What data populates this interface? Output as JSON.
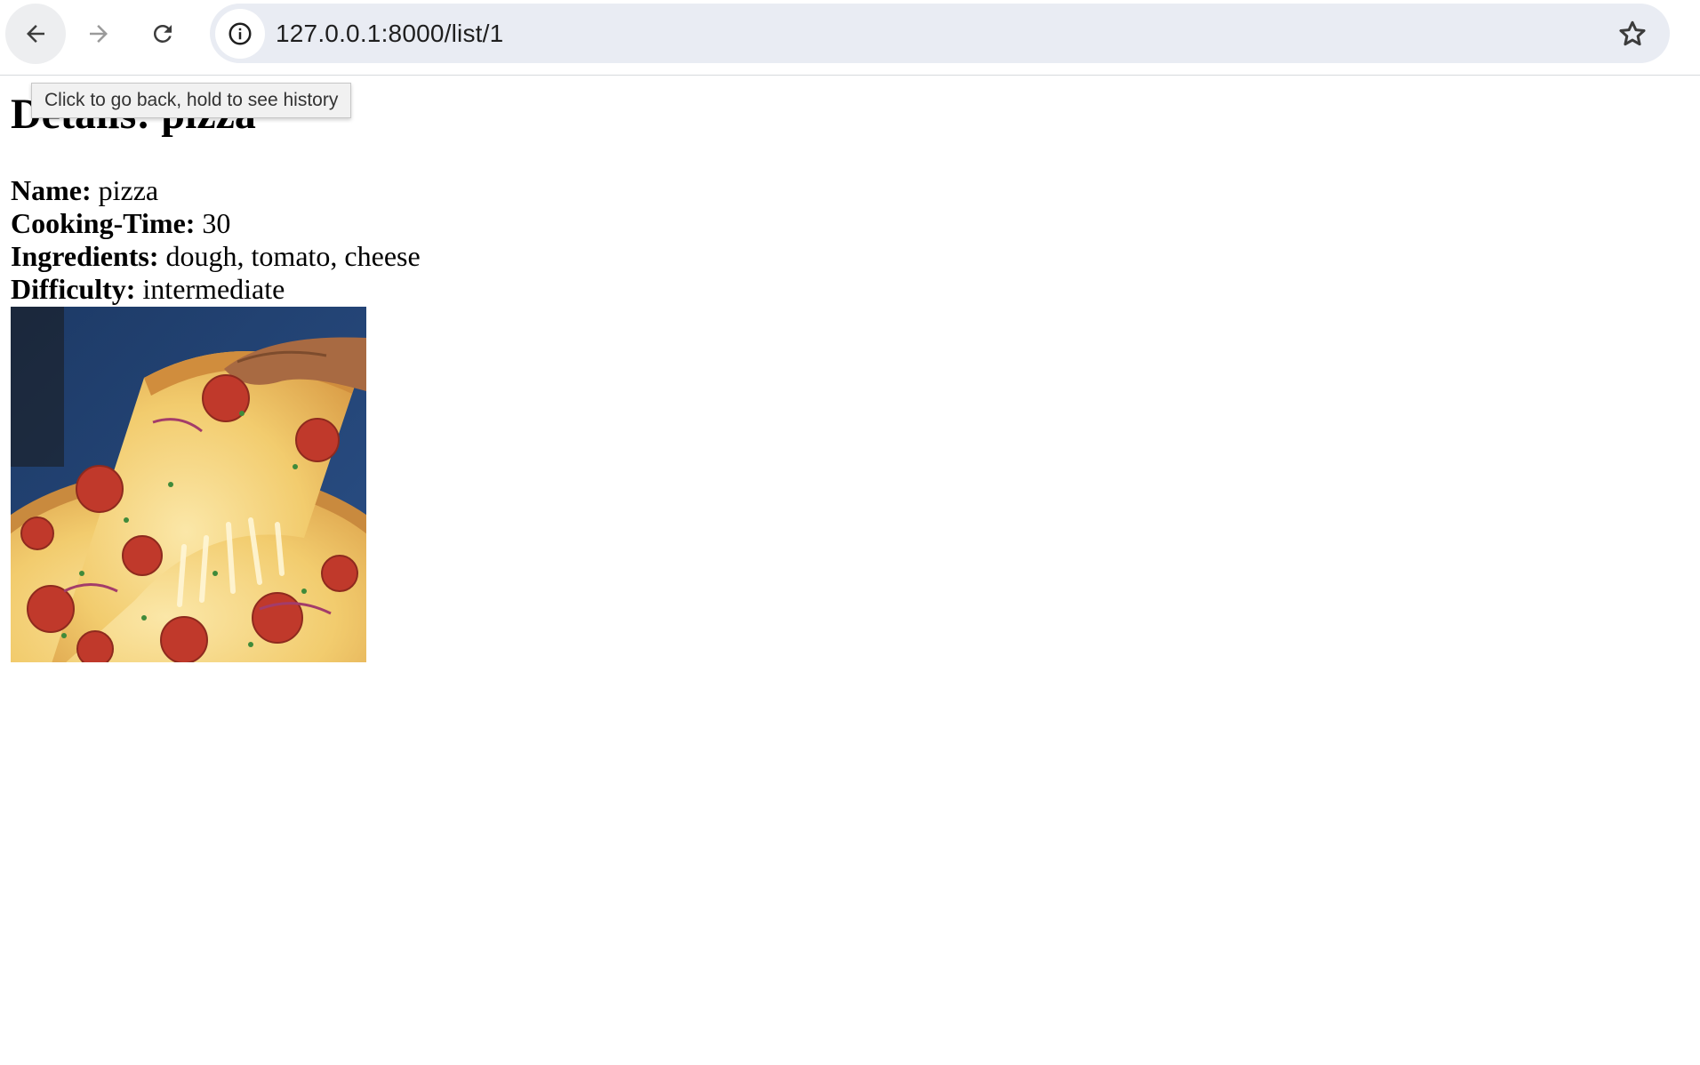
{
  "browser": {
    "url": "127.0.0.1:8000/list/1",
    "tooltip": "Click to go back, hold to see history",
    "icons": {
      "back": "arrow-left-icon",
      "forward": "arrow-right-icon",
      "reload": "reload-icon",
      "site_info": "info-icon",
      "bookmark": "star-icon"
    }
  },
  "page": {
    "title": "Details: pizza",
    "fields": [
      {
        "label": "Name:",
        "value": "pizza"
      },
      {
        "label": "Cooking-Time:",
        "value": "30"
      },
      {
        "label": "Ingredients:",
        "value": "dough, tomato, cheese"
      },
      {
        "label": "Difficulty:",
        "value": "intermediate"
      }
    ],
    "image_subject": "pizza"
  },
  "colors": {
    "toolbar_bg": "#ffffff",
    "omnibox_bg": "#e9ecf3",
    "tooltip_bg": "#f1f1f1",
    "page_bg": "#ffffff"
  }
}
